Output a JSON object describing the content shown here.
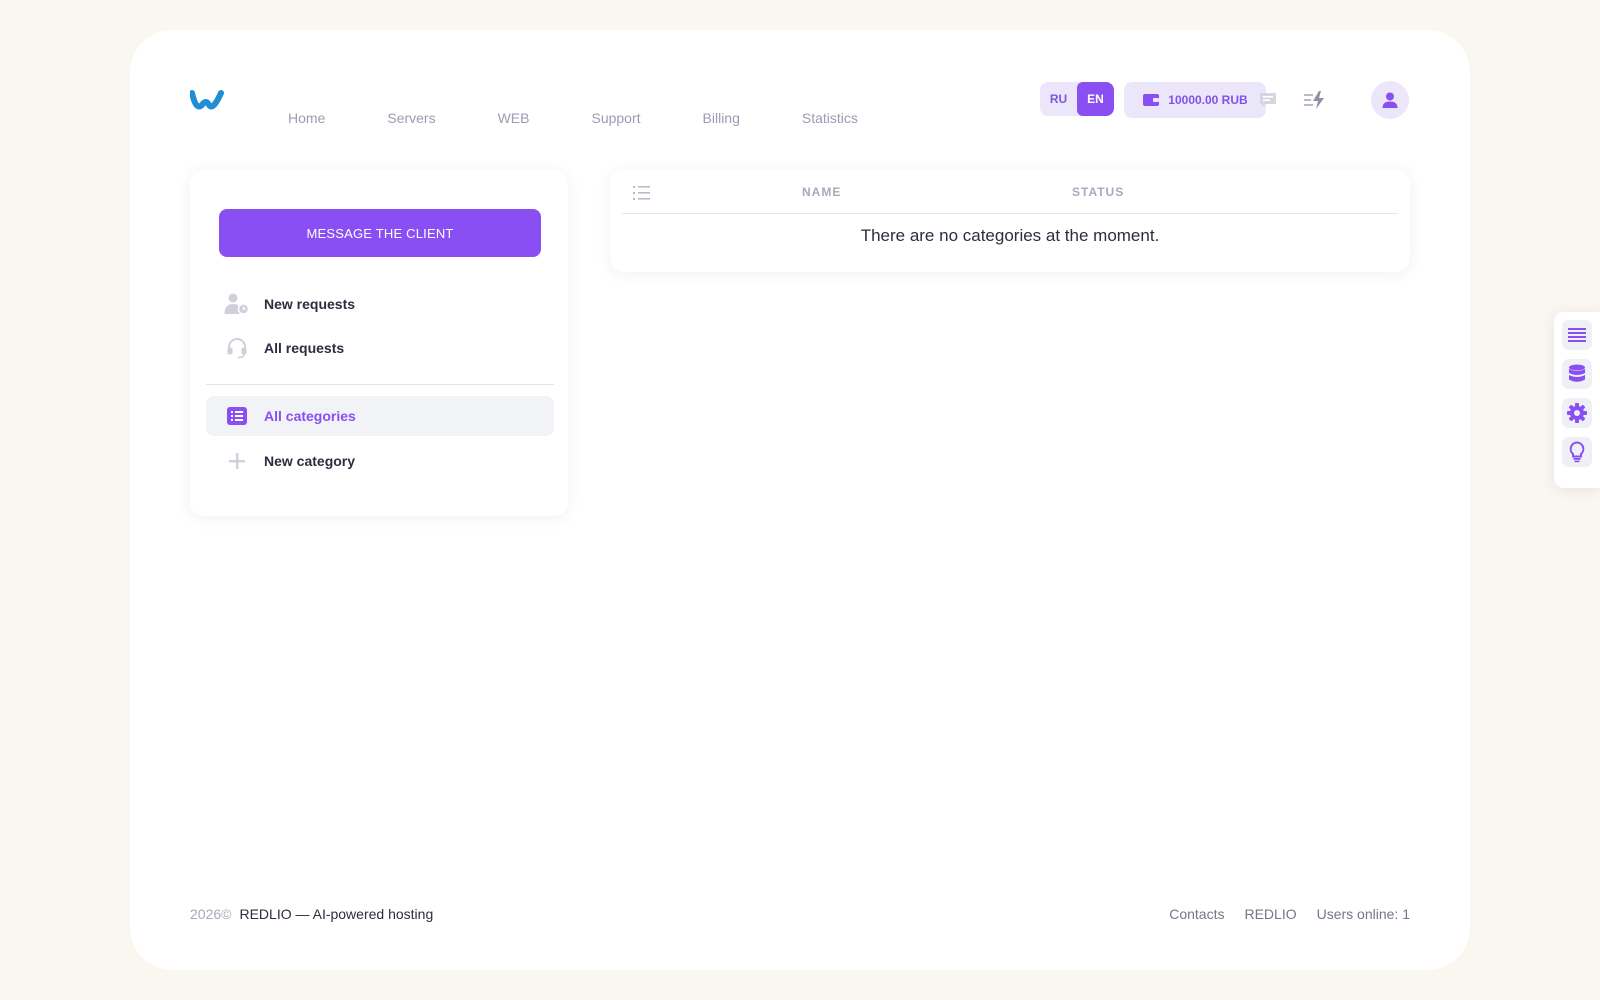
{
  "header": {
    "logo_icon": "wave-logo-icon",
    "nav": [
      "Home",
      "Servers",
      "WEB",
      "Support",
      "Billing",
      "Statistics"
    ],
    "lang": {
      "ru": "RU",
      "en": "EN",
      "active": "EN"
    },
    "balance": "10000.00 RUB",
    "icons": [
      "chat-icon",
      "activity-bolt-icon",
      "user-avatar-icon"
    ]
  },
  "sidebar": {
    "message_button": "MESSAGE THE CLIENT",
    "items": [
      {
        "label": "New requests",
        "icon": "user-clock-icon"
      },
      {
        "label": "All requests",
        "icon": "headset-icon"
      },
      {
        "label": "All categories",
        "icon": "list-icon",
        "active": true
      },
      {
        "label": "New category",
        "icon": "plus-icon"
      }
    ]
  },
  "table": {
    "columns": [
      "NAME",
      "STATUS"
    ],
    "empty_message": "There are no categories at the moment."
  },
  "footer": {
    "year": "2026©",
    "brand": "REDLIO — AI-powered hosting",
    "links": [
      "Contacts",
      "REDLIO"
    ],
    "users_online": "Users online: 1"
  },
  "float_panel": {
    "icons": [
      "list-lines-icon",
      "database-icon",
      "gear-icon",
      "lightbulb-icon"
    ]
  },
  "colors": {
    "accent": "#8a4ff2",
    "accent_light": "#ece6fb",
    "background": "#faf6f0",
    "text": "#2c2d3f",
    "muted": "#9a9db3"
  }
}
